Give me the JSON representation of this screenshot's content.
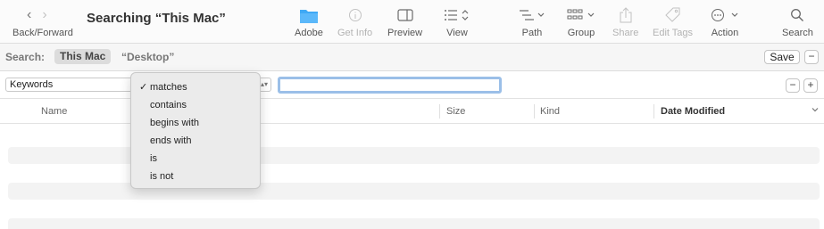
{
  "window": {
    "title": "Searching “This Mac”",
    "nav_label": "Back/Forward"
  },
  "toolbar": {
    "items": [
      {
        "label": "Adobe",
        "icon": "folder-icon",
        "enabled": true
      },
      {
        "label": "Get Info",
        "icon": "info-icon",
        "enabled": false
      },
      {
        "label": "Preview",
        "icon": "preview-icon",
        "enabled": true
      },
      {
        "label": "View",
        "icon": "list-view-icon",
        "enabled": true
      },
      {
        "label": "Path",
        "icon": "path-icon",
        "enabled": true
      },
      {
        "label": "Group",
        "icon": "group-icon",
        "enabled": true
      },
      {
        "label": "Share",
        "icon": "share-icon",
        "enabled": false
      },
      {
        "label": "Edit Tags",
        "icon": "tag-icon",
        "enabled": false
      },
      {
        "label": "Action",
        "icon": "action-icon",
        "enabled": true
      },
      {
        "label": "Search",
        "icon": "search-icon",
        "enabled": true
      }
    ]
  },
  "scope": {
    "label": "Search:",
    "this_mac": "This Mac",
    "desktop": "“Desktop”",
    "save_label": "Save",
    "minus": "−"
  },
  "criteria": {
    "attribute": "Keywords",
    "search_value": "",
    "minus": "−",
    "plus": "+"
  },
  "columns": {
    "name": "Name",
    "size": "Size",
    "kind": "Kind",
    "date_modified": "Date Modified"
  },
  "popup_menu": {
    "selected": "matches",
    "options": [
      "matches",
      "contains",
      "begins with",
      "ends with",
      "is",
      "is not"
    ]
  },
  "colors": {
    "folder_blue": "#3fa9f5",
    "focus_ring": "#9bbfe8"
  }
}
